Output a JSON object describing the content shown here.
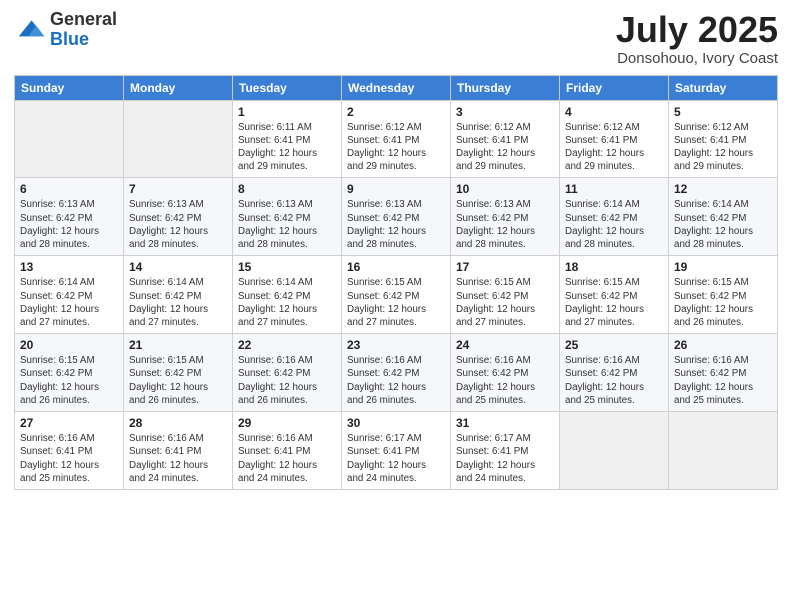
{
  "logo": {
    "general": "General",
    "blue": "Blue"
  },
  "title": "July 2025",
  "subtitle": "Donsohouo, Ivory Coast",
  "weekdays": [
    "Sunday",
    "Monday",
    "Tuesday",
    "Wednesday",
    "Thursday",
    "Friday",
    "Saturday"
  ],
  "weeks": [
    [
      {
        "day": "",
        "info": ""
      },
      {
        "day": "",
        "info": ""
      },
      {
        "day": "1",
        "info": "Sunrise: 6:11 AM\nSunset: 6:41 PM\nDaylight: 12 hours and 29 minutes."
      },
      {
        "day": "2",
        "info": "Sunrise: 6:12 AM\nSunset: 6:41 PM\nDaylight: 12 hours and 29 minutes."
      },
      {
        "day": "3",
        "info": "Sunrise: 6:12 AM\nSunset: 6:41 PM\nDaylight: 12 hours and 29 minutes."
      },
      {
        "day": "4",
        "info": "Sunrise: 6:12 AM\nSunset: 6:41 PM\nDaylight: 12 hours and 29 minutes."
      },
      {
        "day": "5",
        "info": "Sunrise: 6:12 AM\nSunset: 6:41 PM\nDaylight: 12 hours and 29 minutes."
      }
    ],
    [
      {
        "day": "6",
        "info": "Sunrise: 6:13 AM\nSunset: 6:42 PM\nDaylight: 12 hours and 28 minutes."
      },
      {
        "day": "7",
        "info": "Sunrise: 6:13 AM\nSunset: 6:42 PM\nDaylight: 12 hours and 28 minutes."
      },
      {
        "day": "8",
        "info": "Sunrise: 6:13 AM\nSunset: 6:42 PM\nDaylight: 12 hours and 28 minutes."
      },
      {
        "day": "9",
        "info": "Sunrise: 6:13 AM\nSunset: 6:42 PM\nDaylight: 12 hours and 28 minutes."
      },
      {
        "day": "10",
        "info": "Sunrise: 6:13 AM\nSunset: 6:42 PM\nDaylight: 12 hours and 28 minutes."
      },
      {
        "day": "11",
        "info": "Sunrise: 6:14 AM\nSunset: 6:42 PM\nDaylight: 12 hours and 28 minutes."
      },
      {
        "day": "12",
        "info": "Sunrise: 6:14 AM\nSunset: 6:42 PM\nDaylight: 12 hours and 28 minutes."
      }
    ],
    [
      {
        "day": "13",
        "info": "Sunrise: 6:14 AM\nSunset: 6:42 PM\nDaylight: 12 hours and 27 minutes."
      },
      {
        "day": "14",
        "info": "Sunrise: 6:14 AM\nSunset: 6:42 PM\nDaylight: 12 hours and 27 minutes."
      },
      {
        "day": "15",
        "info": "Sunrise: 6:14 AM\nSunset: 6:42 PM\nDaylight: 12 hours and 27 minutes."
      },
      {
        "day": "16",
        "info": "Sunrise: 6:15 AM\nSunset: 6:42 PM\nDaylight: 12 hours and 27 minutes."
      },
      {
        "day": "17",
        "info": "Sunrise: 6:15 AM\nSunset: 6:42 PM\nDaylight: 12 hours and 27 minutes."
      },
      {
        "day": "18",
        "info": "Sunrise: 6:15 AM\nSunset: 6:42 PM\nDaylight: 12 hours and 27 minutes."
      },
      {
        "day": "19",
        "info": "Sunrise: 6:15 AM\nSunset: 6:42 PM\nDaylight: 12 hours and 26 minutes."
      }
    ],
    [
      {
        "day": "20",
        "info": "Sunrise: 6:15 AM\nSunset: 6:42 PM\nDaylight: 12 hours and 26 minutes."
      },
      {
        "day": "21",
        "info": "Sunrise: 6:15 AM\nSunset: 6:42 PM\nDaylight: 12 hours and 26 minutes."
      },
      {
        "day": "22",
        "info": "Sunrise: 6:16 AM\nSunset: 6:42 PM\nDaylight: 12 hours and 26 minutes."
      },
      {
        "day": "23",
        "info": "Sunrise: 6:16 AM\nSunset: 6:42 PM\nDaylight: 12 hours and 26 minutes."
      },
      {
        "day": "24",
        "info": "Sunrise: 6:16 AM\nSunset: 6:42 PM\nDaylight: 12 hours and 25 minutes."
      },
      {
        "day": "25",
        "info": "Sunrise: 6:16 AM\nSunset: 6:42 PM\nDaylight: 12 hours and 25 minutes."
      },
      {
        "day": "26",
        "info": "Sunrise: 6:16 AM\nSunset: 6:42 PM\nDaylight: 12 hours and 25 minutes."
      }
    ],
    [
      {
        "day": "27",
        "info": "Sunrise: 6:16 AM\nSunset: 6:41 PM\nDaylight: 12 hours and 25 minutes."
      },
      {
        "day": "28",
        "info": "Sunrise: 6:16 AM\nSunset: 6:41 PM\nDaylight: 12 hours and 24 minutes."
      },
      {
        "day": "29",
        "info": "Sunrise: 6:16 AM\nSunset: 6:41 PM\nDaylight: 12 hours and 24 minutes."
      },
      {
        "day": "30",
        "info": "Sunrise: 6:17 AM\nSunset: 6:41 PM\nDaylight: 12 hours and 24 minutes."
      },
      {
        "day": "31",
        "info": "Sunrise: 6:17 AM\nSunset: 6:41 PM\nDaylight: 12 hours and 24 minutes."
      },
      {
        "day": "",
        "info": ""
      },
      {
        "day": "",
        "info": ""
      }
    ]
  ]
}
